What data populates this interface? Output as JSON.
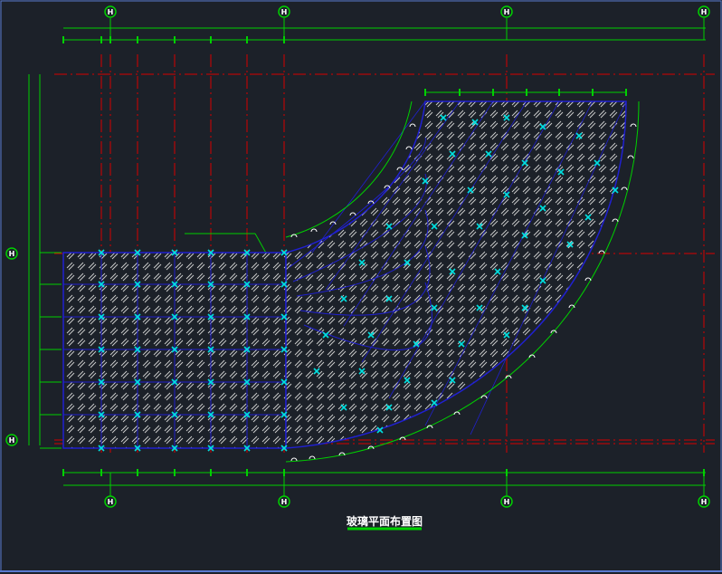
{
  "drawing": {
    "title": "玻璃平面布置图",
    "background": "#1c2129",
    "colors": {
      "axis_line": "#d80000",
      "dimension": "#00d000",
      "outline": "#2020d0",
      "panel": "#ffffff",
      "anchor": "#00e0e0",
      "label_bubble": "#ffffff"
    },
    "axes": {
      "top_labels": [
        "H",
        "H",
        "H",
        "H"
      ],
      "bottom_labels": [
        "H",
        "H",
        "H",
        "H"
      ],
      "left_labels": [
        "H",
        "H"
      ]
    }
  }
}
